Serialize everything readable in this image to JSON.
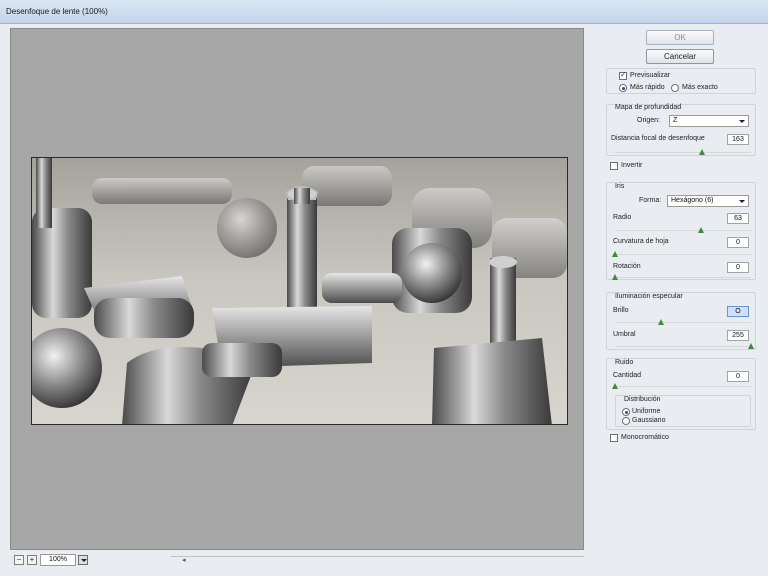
{
  "window": {
    "title": "Desenfoque de lente (100%)"
  },
  "buttons": {
    "ok": "OK",
    "cancel": "Cancelar"
  },
  "preview_options": {
    "preview_label": "Previsualizar",
    "preview_checked": true,
    "faster_label": "Más rápido",
    "accurate_label": "Más exacto",
    "selected": "Más rápido"
  },
  "depth_map": {
    "title": "Mapa de profundidad",
    "source_label": "Origen:",
    "source_value": "Z",
    "focal_label": "Distancia focal de desenfoque",
    "focal_value": "163",
    "focal_fraction": 0.64,
    "invert_label": "Invertir",
    "invert_checked": false
  },
  "iris": {
    "title": "Iris",
    "shape_label": "Forma:",
    "shape_value": "Hexágono (6)",
    "radius_label": "Radio",
    "radius_value": "63",
    "radius_fraction": 0.63,
    "curvature_label": "Curvatura de hoja",
    "curvature_value": "0",
    "curvature_fraction": 0.0,
    "rotation_label": "Rotación",
    "rotation_value": "0",
    "rotation_fraction": 0.0
  },
  "specular": {
    "title": "Iluminación especular",
    "brightness_label": "Brillo",
    "brightness_value": "O",
    "brightness_fraction": 0.34,
    "threshold_label": "Umbral",
    "threshold_value": "255",
    "threshold_fraction": 1.0
  },
  "noise": {
    "title": "Ruido",
    "amount_label": "Cantidad",
    "amount_value": "0",
    "amount_fraction": 0.0,
    "distribution_title": "Distribución",
    "uniform_label": "Uniforme",
    "gaussian_label": "Gaussiano",
    "distribution_selected": "Uniforme",
    "mono_label": "Monocromático",
    "mono_checked": false
  },
  "zoom": {
    "minus": "−",
    "plus": "+",
    "value": "100%"
  },
  "scroll": {
    "left_arrow": "◂"
  }
}
